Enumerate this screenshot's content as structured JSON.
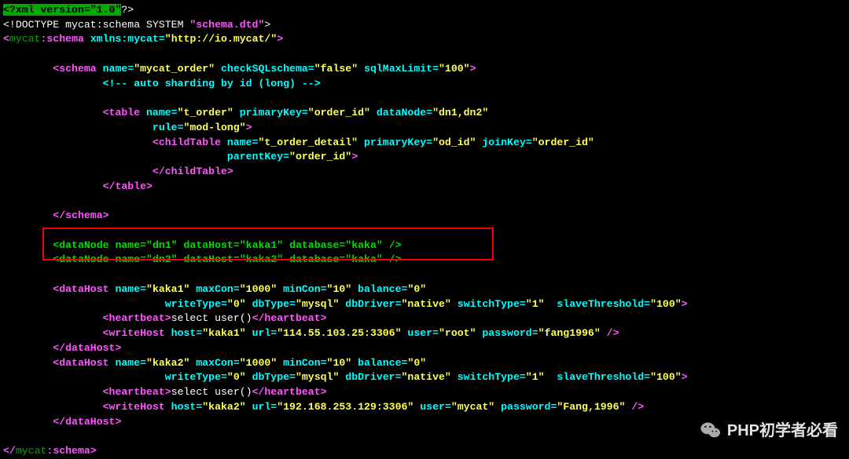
{
  "l1_a": "<?",
  "l1_b": "xml version=\"1.0\"",
  "l1_c": "?>",
  "l2_a": "<!DOCTYPE mycat:schema SYSTEM ",
  "l2_b": "\"schema.dtd\"",
  "l2_c": ">",
  "l3_a": "<",
  "l3_b": "mycat",
  "l3_c": ":schema",
  "l3_d": " xmlns:mycat=",
  "l3_e": "\"http://io.mycat/\"",
  "l3_f": ">",
  "l5_a": "        <schema",
  "l5_b": " name=",
  "l5_c": "\"mycat_order\"",
  "l5_d": " checkSQLschema=",
  "l5_e": "\"false\"",
  "l5_f": " sqlMaxLimit=",
  "l5_g": "\"100\"",
  "l5_h": ">",
  "l6": "                <!-- auto sharding by id (long) -->",
  "l8_a": "                <table",
  "l8_b": " name=",
  "l8_c": "\"t_order\"",
  "l8_d": " primaryKey=",
  "l8_e": "\"order_id\"",
  "l8_f": " dataNode=",
  "l8_g": "\"dn1,dn2\"",
  "l9_a": "                        rule=",
  "l9_b": "\"mod-long\"",
  "l9_c": ">",
  "l10_a": "                        <childTable",
  "l10_b": " name=",
  "l10_c": "\"t_order_detail\"",
  "l10_d": " primaryKey=",
  "l10_e": "\"od_id\"",
  "l10_f": " joinKey=",
  "l10_g": "\"order_id\"",
  "l11_a": "                                    parentKey=",
  "l11_b": "\"order_id\"",
  "l11_c": ">",
  "l12": "                        </childTable>",
  "l13": "                </table>",
  "l15": "        </schema>",
  "l17_a": "        <dataNode",
  "l17_b": " name=",
  "l17_c": "\"dn1\"",
  "l17_d": " dataHost=",
  "l17_e": "\"kaka1\"",
  "l17_f": " database=",
  "l17_g": "\"kaka\"",
  "l17_h": " />",
  "l18_a": "        <dataNode",
  "l18_b": " name=",
  "l18_c": "\"dn2\"",
  "l18_d": " dataHost=",
  "l18_e": "\"kaka2\"",
  "l18_f": " database=",
  "l18_g": "\"kaka\"",
  "l18_h": " />",
  "l20_a": "        <dataHost",
  "l20_b": " name=",
  "l20_c": "\"kaka1\"",
  "l20_d": " maxCon=",
  "l20_e": "\"1000\"",
  "l20_f": " minCon=",
  "l20_g": "\"10\"",
  "l20_h": " balance=",
  "l20_i": "\"0\"",
  "l21_a": "                          writeType=",
  "l21_b": "\"0\"",
  "l21_c": " dbType=",
  "l21_d": "\"mysql\"",
  "l21_e": " dbDriver=",
  "l21_f": "\"native\"",
  "l21_g": " switchType=",
  "l21_h": "\"1\"",
  "l21_i": "  slaveThreshold=",
  "l21_j": "\"100\"",
  "l21_k": ">",
  "l22_a": "                <heartbeat>",
  "l22_b": "select user()",
  "l22_c": "</heartbeat>",
  "l23_a": "                <writeHost",
  "l23_b": " host=",
  "l23_c": "\"kaka1\"",
  "l23_d": " url=",
  "l23_e": "\"114.55.103.25:3306\"",
  "l23_f": " user=",
  "l23_g": "\"root\"",
  "l23_h": " password=",
  "l23_i": "\"fang1996\"",
  "l23_j": " />",
  "l24": "        </dataHost>",
  "l25_a": "        <dataHost",
  "l25_b": " name=",
  "l25_c": "\"kaka2\"",
  "l25_d": " maxCon=",
  "l25_e": "\"1000\"",
  "l25_f": " minCon=",
  "l25_g": "\"10\"",
  "l25_h": " balance=",
  "l25_i": "\"0\"",
  "l26_a": "                          writeType=",
  "l26_b": "\"0\"",
  "l26_c": " dbType=",
  "l26_d": "\"mysql\"",
  "l26_e": " dbDriver=",
  "l26_f": "\"native\"",
  "l26_g": " switchType=",
  "l26_h": "\"1\"",
  "l26_i": "  slaveThreshold=",
  "l26_j": "\"100\"",
  "l26_k": ">",
  "l27_a": "                <heartbeat>",
  "l27_b": "select user()",
  "l27_c": "</heartbeat>",
  "l28_a": "                <writeHost",
  "l28_b": " host=",
  "l28_c": "\"kaka2\"",
  "l28_d": " url=",
  "l28_e": "\"192.168.253.129:3306\"",
  "l28_f": " user=",
  "l28_g": "\"mycat\"",
  "l28_h": " password=",
  "l28_i": "\"Fang,1996\"",
  "l28_j": " />",
  "l29": "        </dataHost>",
  "l31_a": "</",
  "l31_b": "mycat",
  "l31_c": ":schema",
  "l31_d": ">",
  "watermark": "PHP初学者必看"
}
